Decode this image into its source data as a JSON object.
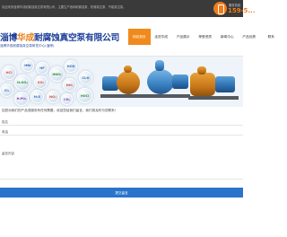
{
  "topbar": {
    "welcome_text": "欢迎来到淄博华成耐腐蚀真空泵有限公司，主要生产各种耐腐蚀泵、防爆真空泵、节能真空泵。",
    "phone_caption": "服务热线",
    "phone_number": "159-5...",
    "accent_color": "#f07c1c"
  },
  "header": {
    "logo_prefix": "淄博",
    "logo_accent": "华成",
    "logo_suffix": "耐腐蚀真空泵有限公司",
    "logo_subtitle": "淄博华成耐腐蚀真空泵研发中心(淄博)",
    "brand_color": "#1e3f9a",
    "nav_items": [
      {
        "label": "网站首页",
        "active": true
      },
      {
        "label": "走进华成",
        "active": false
      },
      {
        "label": "产品展示",
        "active": false
      },
      {
        "label": "荣誉资质",
        "active": false
      },
      {
        "label": "新闻中心",
        "active": false
      },
      {
        "label": "产品优势",
        "active": false
      },
      {
        "label": "联系"
      }
    ]
  },
  "banner": {
    "bubbles": [
      "HBr",
      "HCl",
      "HF",
      "H₂SO₄",
      "SO₂",
      "Cl₂",
      "H₃PO₄",
      "H₂S",
      "NO₂",
      "HNO₃",
      "HCN",
      "NH₃",
      "Cl₂O",
      "HOCl",
      "CH₃"
    ]
  },
  "message": {
    "intro_text": "如您对我们的产品或服务有任何需要，欢迎您给我们留言，我们将及时与您联系！",
    "name_placeholder": "姓名",
    "phone_placeholder": "电话",
    "content_placeholder": "留言内容",
    "submit_label": "提交留言",
    "button_color": "#2a74cc"
  }
}
